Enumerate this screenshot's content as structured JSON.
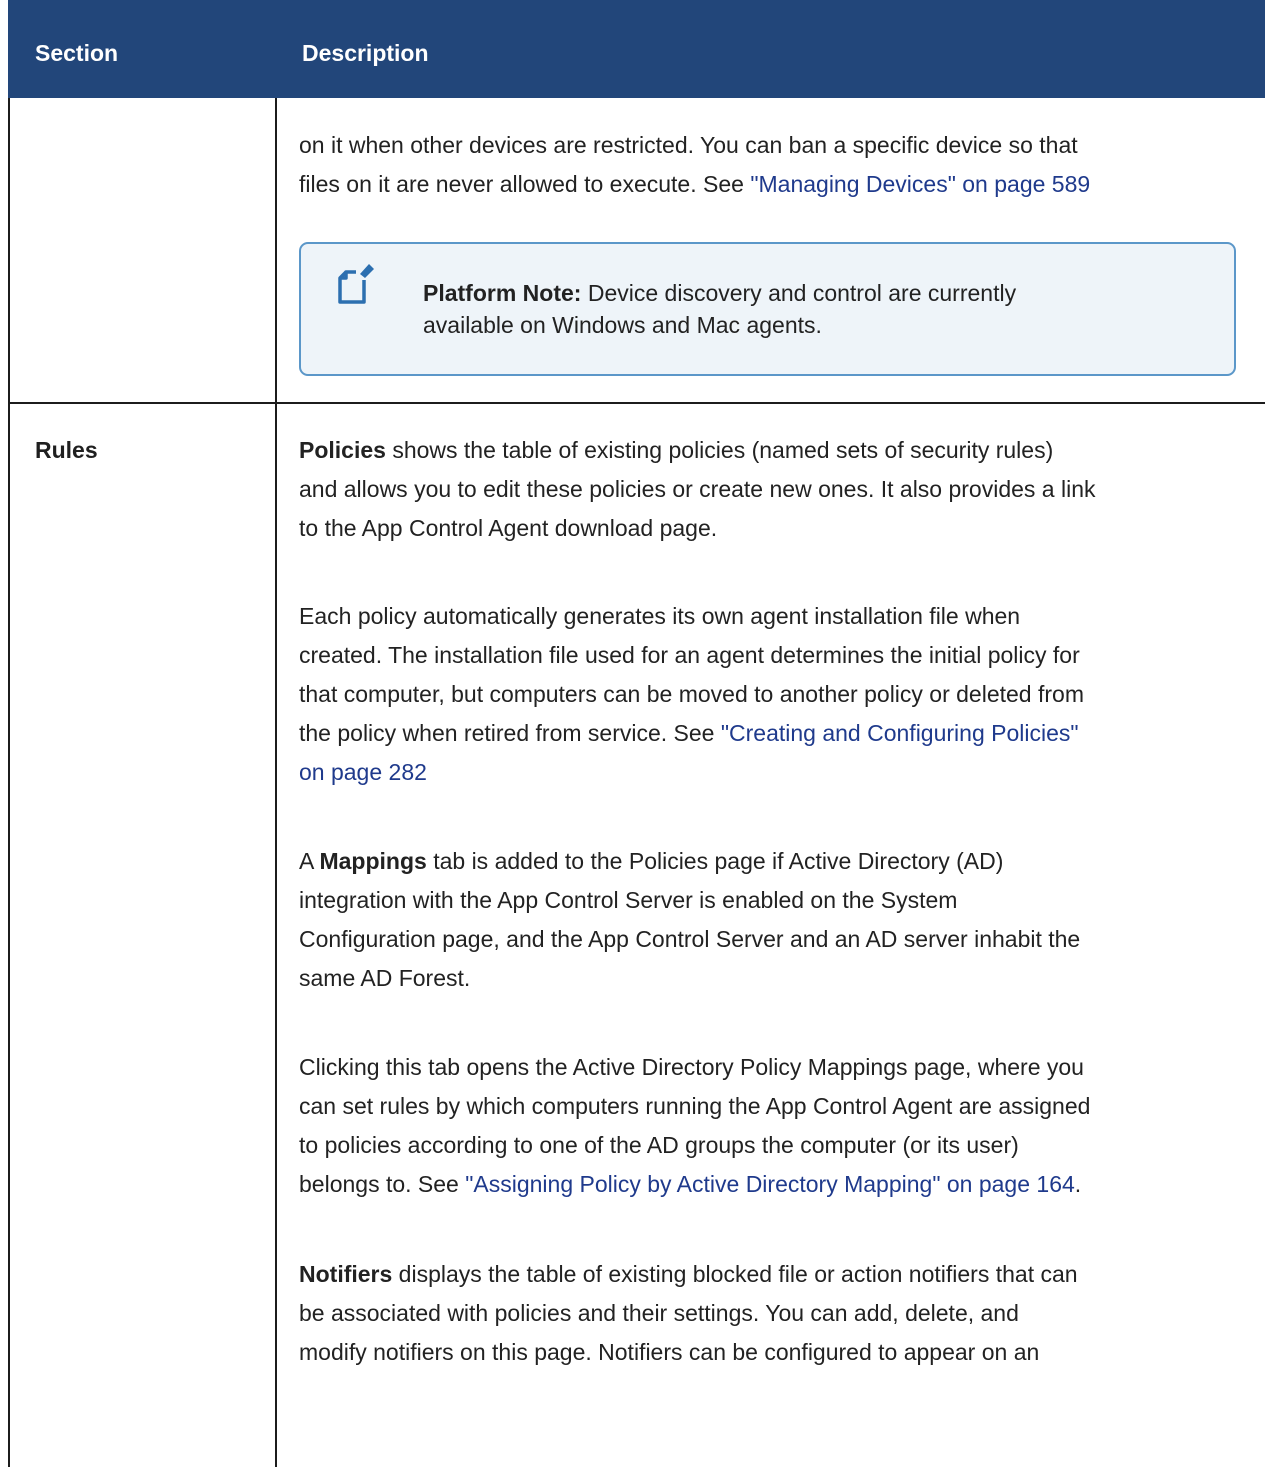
{
  "table": {
    "header": {
      "section": "Section",
      "description": "Description"
    },
    "row1": {
      "line1": "on it when other devices are restricted. You can ban a specific device so that",
      "line2_prefix": "files on it are never allowed to execute. See ",
      "line2_link": "\"Managing Devices\" on page 589",
      "note": {
        "icon": "note-pencil-icon",
        "label": "Platform Note:",
        "text_line1": " Device discovery and control are currently",
        "text_line2": "available on Windows and Mac agents."
      }
    },
    "row2": {
      "section": "Rules",
      "p1": {
        "bold": "Policies",
        "l1": " shows the table of existing policies (named sets of security rules)",
        "l2": "and allows you to edit these policies or create new ones. It also provides a link",
        "l3": "to the App Control Agent download page."
      },
      "p2": {
        "l1": "Each policy automatically generates its own agent installation file when",
        "l2": "created. The installation file used for an agent determines the initial policy for",
        "l3": "that computer, but computers can be moved to another policy or deleted from",
        "l4_prefix": "the policy when retired from service. See ",
        "l4_link": "\"Creating and Configuring Policies\"",
        "l5_link": "on page 282"
      },
      "p3": {
        "prefix": "A ",
        "bold": "Mappings",
        "l1": " tab is added to the Policies page if Active Directory (AD)",
        "l2": "integration with the App Control Server is enabled on the System",
        "l3": "Configuration page, and the App Control Server and an AD server inhabit the",
        "l4": "same AD Forest."
      },
      "p4": {
        "l1": "Clicking this tab opens the Active Directory Policy Mappings page, where you",
        "l2": "can set rules by which computers running the App Control Agent are assigned",
        "l3": "to policies according to one of the AD groups the computer (or its user)",
        "l4_prefix": "belongs to. See ",
        "l4_link": "\"Assigning Policy by Active Directory Mapping\" on page 164",
        "l4_suffix": "."
      },
      "p5": {
        "bold": "Notifiers",
        "l1": " displays the table of existing blocked file or action notifiers that can",
        "l2": "be associated with policies and their settings. You can add, delete, and",
        "l3": "modify notifiers on this page. Notifiers can be configured to appear on an"
      }
    }
  },
  "colors": {
    "header_bg": "#22467a",
    "link": "#1f3a8c",
    "note_border": "#5b97c9",
    "note_bg": "#eef4f9"
  }
}
